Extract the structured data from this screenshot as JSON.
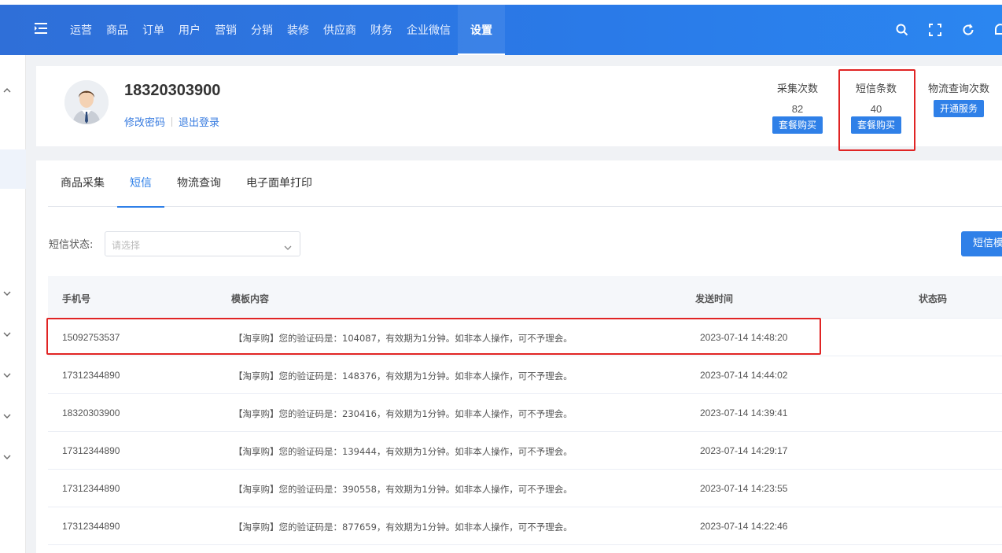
{
  "nav": {
    "items": [
      "运营",
      "商品",
      "订单",
      "用户",
      "营销",
      "分销",
      "装修",
      "供应商",
      "财务",
      "企业微信",
      "设置"
    ],
    "active": "设置"
  },
  "icons": [
    "menu-fold-icon",
    "search-icon",
    "fullscreen-icon",
    "refresh-icon",
    "bell-icon"
  ],
  "profile": {
    "username": "18320303900",
    "change_password": "修改密码",
    "logout": "退出登录"
  },
  "stats": {
    "collect": {
      "label": "采集次数",
      "value": "82",
      "button": "套餐购买"
    },
    "sms": {
      "label": "短信条数",
      "value": "40",
      "button": "套餐购买"
    },
    "logistics": {
      "label": "物流查询次数",
      "button": "开通服务"
    }
  },
  "tabs": [
    "商品采集",
    "短信",
    "物流查询",
    "电子面单打印"
  ],
  "active_tab": "短信",
  "filter": {
    "label": "短信状态:",
    "placeholder": "请选择",
    "button": "短信模"
  },
  "table": {
    "headers": [
      "手机号",
      "模板内容",
      "发送时间",
      "状态码"
    ],
    "rows": [
      {
        "phone": "15092753537",
        "content": "【淘享购】您的验证码是：104087，有效期为1分钟。如非本人操作，可不予理会。",
        "time": "2023-07-14 14:48:20"
      },
      {
        "phone": "17312344890",
        "content": "【淘享购】您的验证码是：148376，有效期为1分钟。如非本人操作，可不予理会。",
        "time": "2023-07-14 14:44:02"
      },
      {
        "phone": "18320303900",
        "content": "【淘享购】您的验证码是：230416，有效期为1分钟。如非本人操作，可不予理会。",
        "time": "2023-07-14 14:39:41"
      },
      {
        "phone": "17312344890",
        "content": "【淘享购】您的验证码是：139444，有效期为1分钟。如非本人操作，可不予理会。",
        "time": "2023-07-14 14:29:17"
      },
      {
        "phone": "17312344890",
        "content": "【淘享购】您的验证码是：390558，有效期为1分钟。如非本人操作，可不予理会。",
        "time": "2023-07-14 14:23:55"
      },
      {
        "phone": "17312344890",
        "content": "【淘享购】您的验证码是：877659，有效期为1分钟。如非本人操作，可不予理会。",
        "time": "2023-07-14 14:22:46"
      }
    ]
  },
  "colors": {
    "primary": "#2f80e8",
    "highlight": "#e02424"
  }
}
